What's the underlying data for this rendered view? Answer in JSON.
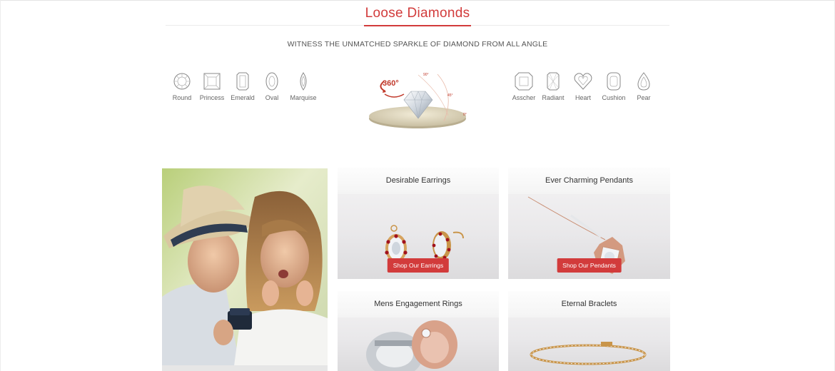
{
  "header": {
    "title": "Loose Diamonds",
    "subtitle": "WITNESS THE UNMATCHED SPARKLE OF DIAMOND FROM ALL ANGLE"
  },
  "shapes_left": [
    {
      "label": "Round",
      "icon": "round-diamond-icon"
    },
    {
      "label": "Princess",
      "icon": "princess-diamond-icon"
    },
    {
      "label": "Emerald",
      "icon": "emerald-diamond-icon"
    },
    {
      "label": "Oval",
      "icon": "oval-diamond-icon"
    },
    {
      "label": "Marquise",
      "icon": "marquise-diamond-icon"
    }
  ],
  "shapes_right": [
    {
      "label": "Asscher",
      "icon": "asscher-diamond-icon"
    },
    {
      "label": "Radiant",
      "icon": "radiant-diamond-icon"
    },
    {
      "label": "Heart",
      "icon": "heart-diamond-icon"
    },
    {
      "label": "Cushion",
      "icon": "cushion-diamond-icon"
    },
    {
      "label": "Pear",
      "icon": "pear-diamond-icon"
    }
  ],
  "viewer360": {
    "badge": "360°",
    "angles": [
      "90°",
      "45°",
      "0°"
    ]
  },
  "cards": {
    "earrings": {
      "title": "Desirable Earrings",
      "button": "Shop Our Earrings"
    },
    "pendants": {
      "title": "Ever Charming Pendants",
      "button": "Shop Our Pendants"
    },
    "mens_rings": {
      "title": "Mens Engagement Rings"
    },
    "bracelets": {
      "title": "Eternal Braclets"
    }
  },
  "colors": {
    "accent": "#d23b3b",
    "text": "#333333",
    "muted": "#666666",
    "card_bg": "#e9e8ea"
  }
}
